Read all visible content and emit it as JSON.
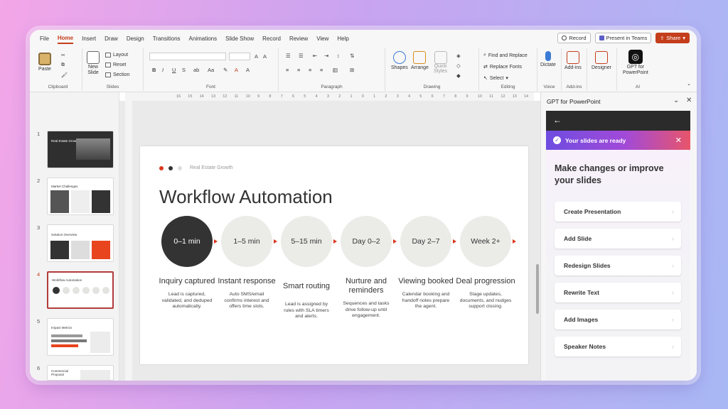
{
  "menu": {
    "items": [
      "File",
      "Home",
      "Insert",
      "Draw",
      "Design",
      "Transitions",
      "Animations",
      "Slide Show",
      "Record",
      "Review",
      "View",
      "Help"
    ],
    "active": "Home",
    "record_label": "Record",
    "present_label": "Present in Teams",
    "share_label": "Share"
  },
  "ribbon": {
    "paste": "Paste",
    "clipboard": "Clipboard",
    "new_slide": "New",
    "new_slide2": "Slide",
    "layout": "Layout",
    "reset": "Reset",
    "section": "Section",
    "slides": "Slides",
    "font": "Font",
    "paragraph": "Paragraph",
    "shapes": "Shapes",
    "arrange": "Arrange",
    "quick_styles": "Quick",
    "quick_styles2": "Styles",
    "drawing": "Drawing",
    "find_replace": "Find and Replace",
    "replace_fonts": "Replace Fonts",
    "select": "Select",
    "editing": "Editing",
    "dictate": "Dictate",
    "voice": "Voice",
    "addins": "Add-ins",
    "addins_group": "Add-ins",
    "designer": "Designer",
    "gpt": "GPT for",
    "gpt2": "PowerPoint",
    "ai": "AI"
  },
  "ruler": [
    "16",
    "15",
    "14",
    "13",
    "12",
    "11",
    "10",
    "9",
    "8",
    "7",
    "6",
    "5",
    "4",
    "3",
    "2",
    "1",
    "0",
    "1",
    "2",
    "3",
    "4",
    "5",
    "6",
    "7",
    "8",
    "9",
    "10",
    "11",
    "12",
    "13",
    "14",
    "15",
    "16"
  ],
  "thumbnails": [
    {
      "num": "1",
      "title": "Real Estate Growth"
    },
    {
      "num": "2",
      "title": "Market Challenges"
    },
    {
      "num": "3",
      "title": "Solution Overview"
    },
    {
      "num": "4",
      "title": "Workflow Automation"
    },
    {
      "num": "5",
      "title": "Impact Metrics"
    },
    {
      "num": "6",
      "title": "Commercial Proposal"
    }
  ],
  "slide": {
    "brand": "Real Estate Growth",
    "title": "Workflow Automation",
    "steps": [
      {
        "time": "0–1 min",
        "title": "Inquiry captured",
        "desc": "Lead is captured, validated, and deduped automatically."
      },
      {
        "time": "1–5 min",
        "title": "Instant response",
        "desc": "Auto SMS/email confirms interest and offers time slots."
      },
      {
        "time": "5–15 min",
        "title": "Smart routing",
        "desc": "Lead is assigned by rules with SLA timers and alerts."
      },
      {
        "time": "Day 0–2",
        "title": "Nurture and reminders",
        "desc": "Sequences and tasks drive follow-up until engagement."
      },
      {
        "time": "Day 2–7",
        "title": "Viewing booked",
        "desc": "Calendar booking and handoff notes prepare the agent."
      },
      {
        "time": "Week 2+",
        "title": "Deal progression",
        "desc": "Stage updates, documents, and nudges support closing."
      }
    ]
  },
  "panel": {
    "title": "GPT for PowerPoint",
    "ready": "Your slides are ready",
    "heading": "Make changes or improve your slides",
    "actions": [
      "Create Presentation",
      "Add Slide",
      "Redesign Slides",
      "Rewrite Text",
      "Add Images",
      "Speaker Notes"
    ]
  },
  "colors": {
    "accent": "#c43e1c",
    "arrow": "#d9381e",
    "dark_circle": "#333333"
  }
}
